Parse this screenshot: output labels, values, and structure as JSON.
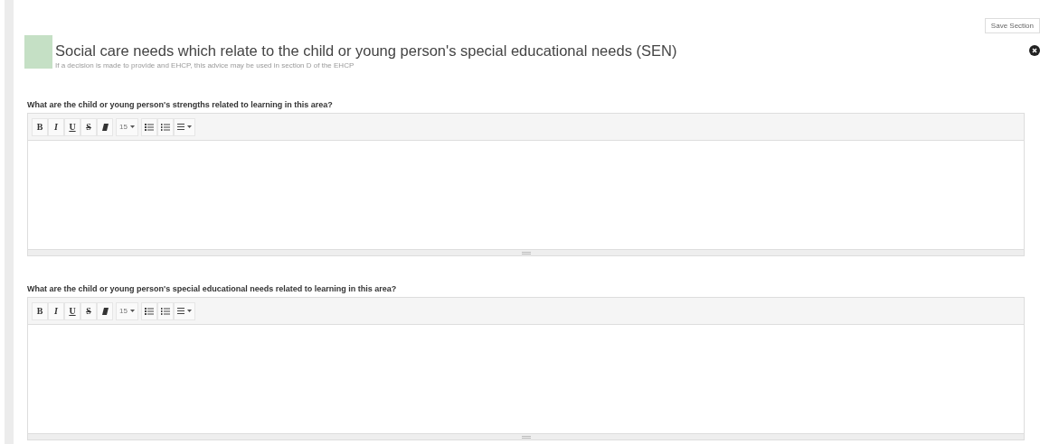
{
  "save_button": {
    "label": "Save Section"
  },
  "section": {
    "title": "Social care needs which relate to the child or young person's special educational needs (SEN)",
    "subtitle": "If a decision is made to provide and EHCP, this advice may be used in section D of the EHCP",
    "color": "#c5e0c5"
  },
  "editors": [
    {
      "question": "What are the child or young person's strengths related to learning in this area?",
      "font_size": "15",
      "toolbar": [
        {
          "kind": "bold",
          "label": "B"
        },
        {
          "kind": "italic",
          "label": "I"
        },
        {
          "kind": "underline",
          "label": "U"
        },
        {
          "kind": "strike",
          "label": "S"
        },
        {
          "kind": "eraser"
        },
        {
          "kind": "size"
        },
        {
          "kind": "bullets"
        },
        {
          "kind": "numbers"
        },
        {
          "kind": "align"
        }
      ]
    },
    {
      "question": "What are the child or young person's special educational needs related to learning in this area?",
      "font_size": "15",
      "toolbar": [
        {
          "kind": "bold",
          "label": "B"
        },
        {
          "kind": "italic",
          "label": "I"
        },
        {
          "kind": "underline",
          "label": "U"
        },
        {
          "kind": "strike",
          "label": "S"
        },
        {
          "kind": "eraser"
        },
        {
          "kind": "size"
        },
        {
          "kind": "bullets"
        },
        {
          "kind": "numbers"
        },
        {
          "kind": "align"
        }
      ]
    }
  ]
}
